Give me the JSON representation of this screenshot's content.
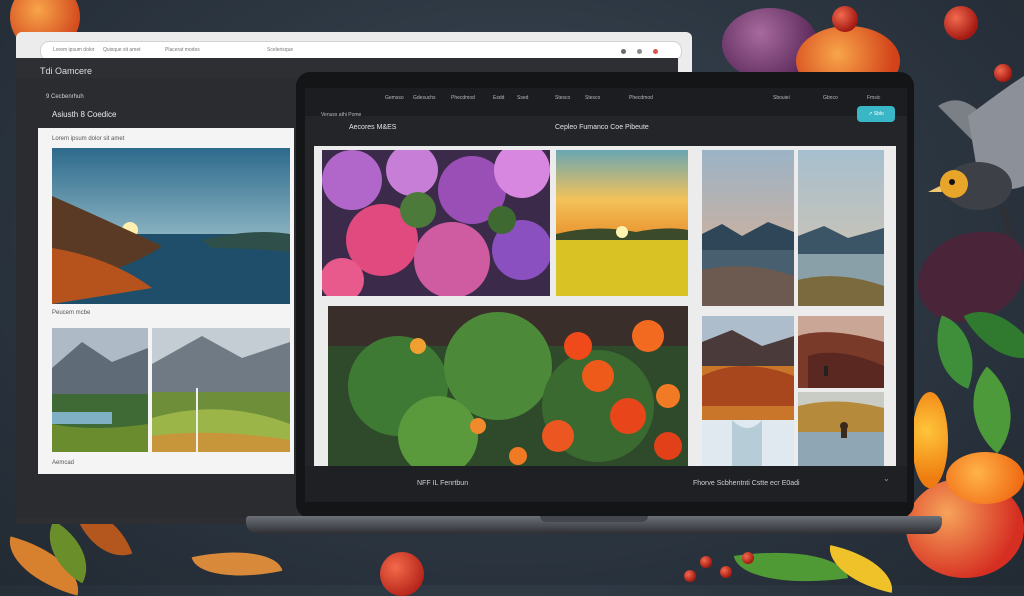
{
  "browser": {
    "address_items": [
      "Lorem ipsum dolor",
      "Quisque sit amet",
      "Placerat modes",
      "Scelerisque"
    ],
    "window_buttons": [
      "#6b6b6b",
      "#8a8a8a",
      "#d9534f"
    ]
  },
  "back_app": {
    "title": "Tdi Oamcere",
    "panel_heading": "9 Cecbenrhuh",
    "panel_subheading": "Asiusth 8 Coedice",
    "caption_top": "Lorem ipsum dolor sit amet",
    "caption_mid": "Peucem mcbe",
    "caption_bottom": "Aemcad"
  },
  "laptop_app": {
    "nav_left": [
      "Gemsso",
      "Gdesuchs",
      "Phecdmod",
      "Esdd",
      "Ssed",
      "Stesco"
    ],
    "nav_right": [
      "Sbouiei",
      "Gbnco",
      "Fmsic"
    ],
    "toolbar_left_small": "Venuss athi Pome",
    "toolbar_left_large": "Aecores M&ES",
    "toolbar_center": "Cepleo Fumanco Coe Pibeute",
    "share_button": "Sblo",
    "footer_left": "NFF IL Fenrtbun",
    "footer_right": "Fhorve Scbhentnti Cstte ecr E0adi"
  },
  "colors": {
    "accent": "#39b7c6",
    "screen_bg": "#242528",
    "board_bg": "#ececec"
  },
  "icons": {
    "share": "share-icon",
    "chevron": "chevron-down-icon"
  }
}
